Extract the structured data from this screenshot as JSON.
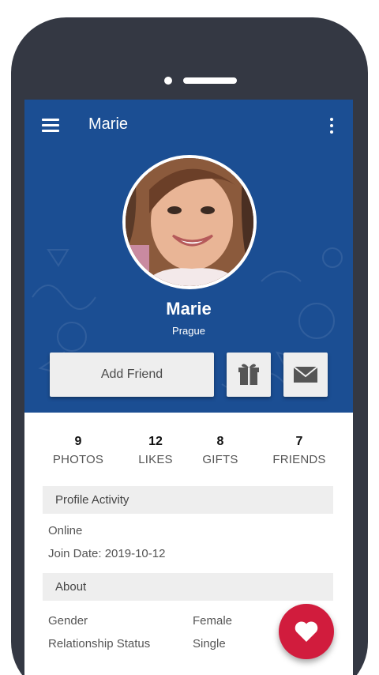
{
  "appbar": {
    "title": "Marie",
    "menu_icon": "hamburger-menu-icon",
    "more_icon": "more-vert-icon"
  },
  "profile": {
    "name": "Marie",
    "city": "Prague",
    "avatar": "profile-photo"
  },
  "actions": {
    "add_friend_label": "Add Friend",
    "gift_icon": "gift-icon",
    "message_icon": "envelope-icon"
  },
  "stats": [
    {
      "value": "9",
      "label": "PHOTOS"
    },
    {
      "value": "12",
      "label": "LIKES"
    },
    {
      "value": "8",
      "label": "GIFTS"
    },
    {
      "value": "7",
      "label": "FRIENDS"
    }
  ],
  "activity": {
    "heading": "Profile Activity",
    "status": "Online",
    "join_date": "Join Date: 2019-10-12"
  },
  "about": {
    "heading": "About",
    "rows": [
      {
        "label": "Gender",
        "value": "Female"
      },
      {
        "label": "Relationship Status",
        "value": "Single"
      }
    ]
  },
  "fab_icon": "heart-icon",
  "colors": {
    "header_blue": "#1b4e93",
    "phone_frame": "#343843",
    "fab_red": "#d11c3d",
    "button_gray": "#eeeeee"
  }
}
